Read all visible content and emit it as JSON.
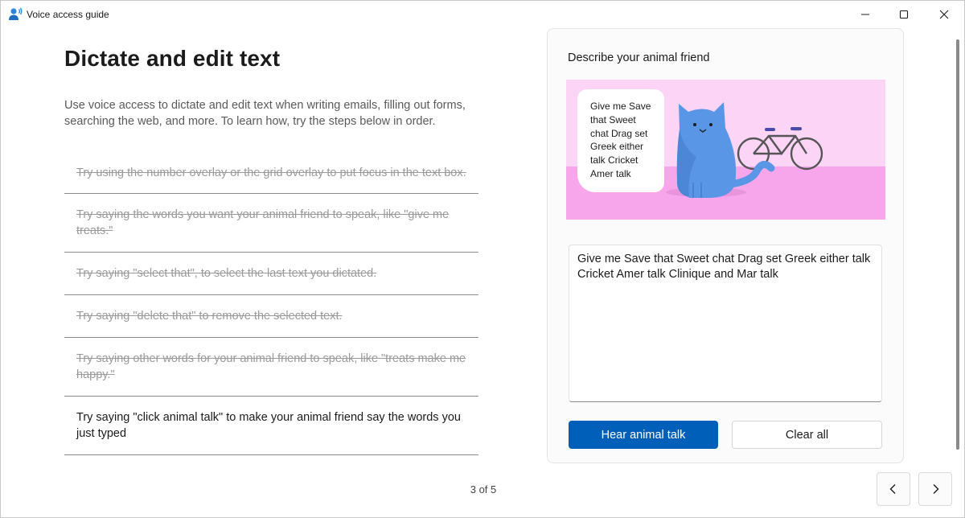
{
  "window": {
    "title": "Voice access guide",
    "icon": "voice-access-icon"
  },
  "main": {
    "title": "Dictate and edit text",
    "intro": "Use voice access to dictate and edit text when writing emails, filling out forms, searching the web, and more. To learn how, try the steps below in order.",
    "steps": [
      {
        "text": "Try using the number overlay or the grid overlay to put focus in the text box.",
        "status": "done"
      },
      {
        "text": "Try saying the words you want your animal friend to speak, like \"give me treats.\"",
        "status": "done"
      },
      {
        "text": "Try saying \"select that\", to select the last text you dictated.",
        "status": "done"
      },
      {
        "text": "Try saying \"delete that\" to remove the selected text.",
        "status": "done"
      },
      {
        "text": "Try saying other words for your animal friend to speak, like \"treats make me happy.\"",
        "status": "done"
      },
      {
        "text": "Try saying \"click animal talk\" to make your animal friend say the words you just typed",
        "status": "current"
      }
    ]
  },
  "pager": {
    "text": "3 of 5"
  },
  "practice": {
    "title": "Describe your animal friend",
    "bubble_text": "Give me Save that Sweet chat Drag set Greek either talk Cricket Amer talk",
    "textbox_value": "Give me Save that Sweet chat Drag set Greek either talk Cricket Amer talk Clinique and Mar talk",
    "hear_button": "Hear animal talk",
    "clear_button": "Clear all"
  },
  "colors": {
    "accent": "#005fb8",
    "illustration_bg": "#fcd4f6",
    "illustration_floor": "#f7a6ec",
    "cat": "#5a96e6"
  }
}
